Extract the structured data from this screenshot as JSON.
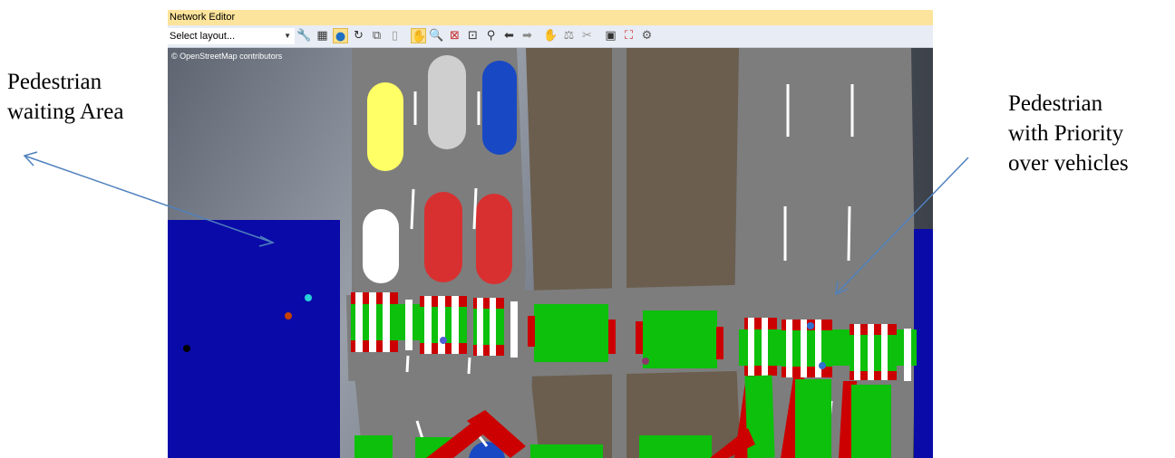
{
  "annotations": {
    "left": [
      "Pedestrian",
      "waiting Area"
    ],
    "right": [
      "Pedestrian",
      "with Priority",
      "over vehicles"
    ]
  },
  "window": {
    "title": "Network Editor"
  },
  "toolbar": {
    "layout_select": {
      "value": "Select layout..."
    },
    "buttons": [
      {
        "name": "edit-tool-icon",
        "glyph": "🔧",
        "color": "#2e7d32",
        "active": false
      },
      {
        "name": "grid-icon",
        "glyph": "▦",
        "color": "#333333",
        "active": false
      },
      {
        "name": "globe-icon",
        "glyph": "●",
        "color": "#1e6fc4",
        "active": true
      },
      {
        "name": "rotate-icon",
        "glyph": "↻",
        "color": "#333333",
        "active": false
      },
      {
        "name": "copy-icon",
        "glyph": "⧉",
        "color": "#555555",
        "active": false
      },
      {
        "name": "delete-icon",
        "glyph": "▯",
        "color": "#999999",
        "active": false
      },
      {
        "name": "pan-hand-icon",
        "glyph": "✋",
        "color": "#b06010",
        "active": true
      },
      {
        "name": "zoom-icon",
        "glyph": "🔍",
        "color": "#333333",
        "active": false
      },
      {
        "name": "zoom-extent-icon",
        "glyph": "⊠",
        "color": "#c62828",
        "active": false
      },
      {
        "name": "zoom-window-icon",
        "glyph": "⊡",
        "color": "#333333",
        "active": false
      },
      {
        "name": "zoom-out-icon",
        "glyph": "⚲",
        "color": "#333333",
        "active": false
      },
      {
        "name": "back-icon",
        "glyph": "⬅",
        "color": "#333333",
        "active": false
      },
      {
        "name": "forward-icon",
        "glyph": "➡",
        "color": "#888888",
        "active": false
      },
      {
        "name": "select-hand-icon",
        "glyph": "✋",
        "color": "#333333",
        "active": false
      },
      {
        "name": "measure-icon",
        "glyph": "⚖",
        "color": "#888888",
        "active": false
      },
      {
        "name": "disabled-tool-icon",
        "glyph": "✂",
        "color": "#999999",
        "active": false
      },
      {
        "name": "screenshot-icon",
        "glyph": "▣",
        "color": "#333333",
        "active": false
      },
      {
        "name": "export-icon",
        "glyph": "⛶",
        "color": "#c62828",
        "active": false
      },
      {
        "name": "settings-icon",
        "glyph": "⚙",
        "color": "#555555",
        "active": false
      }
    ]
  },
  "map": {
    "attribution": "© OpenStreetMap contributors"
  },
  "colors": {
    "road": "#7d7d7d",
    "median": "#6b5e4e",
    "pedestrian_area": "#0a0aa8",
    "crossing_green": "#0cc00c",
    "crossing_red": "#cc0000",
    "crossing_white": "#ffffff"
  }
}
